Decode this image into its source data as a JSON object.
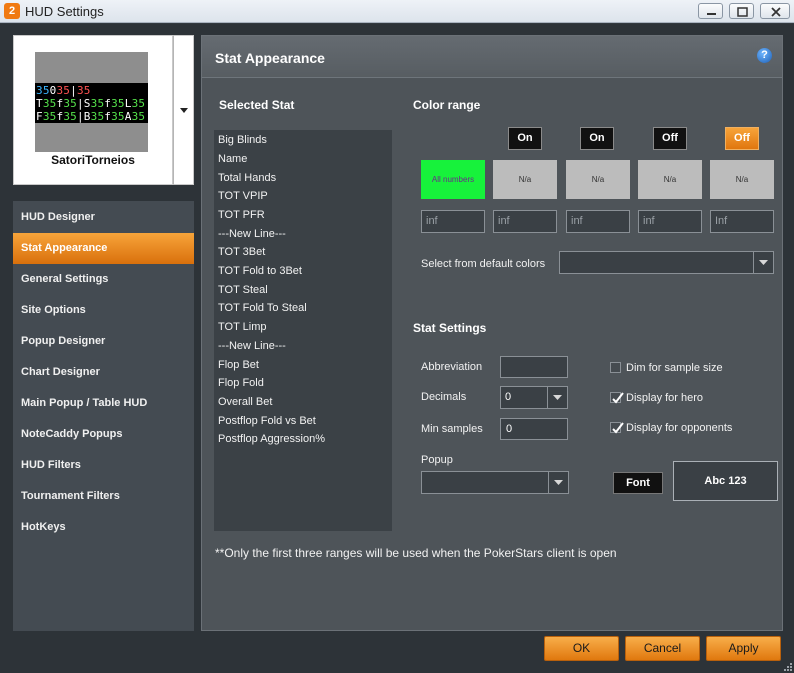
{
  "window": {
    "title": "HUD Settings",
    "app_icon": "2"
  },
  "profile": {
    "name": "SatoriTorneios",
    "preview_lines": [
      [
        [
          "35",
          "b"
        ],
        [
          "0",
          "w"
        ],
        [
          "35",
          "r"
        ],
        [
          "|",
          "w"
        ],
        [
          "35",
          "r"
        ]
      ],
      [
        [
          "T",
          "w"
        ],
        [
          "35",
          "g"
        ],
        [
          "f",
          "w"
        ],
        [
          "35",
          "g"
        ],
        [
          "|",
          "w"
        ],
        [
          "S",
          "w"
        ],
        [
          "35",
          "g"
        ],
        [
          "f",
          "w"
        ],
        [
          "35",
          "g"
        ],
        [
          "L",
          "w"
        ],
        [
          "35",
          "g"
        ]
      ],
      [
        [
          "F",
          "w"
        ],
        [
          "35",
          "g"
        ],
        [
          "f",
          "w"
        ],
        [
          "35",
          "g"
        ],
        [
          "|",
          "w"
        ],
        [
          "B",
          "w"
        ],
        [
          "35",
          "g"
        ],
        [
          "f",
          "w"
        ],
        [
          "35",
          "g"
        ],
        [
          "A",
          "w"
        ],
        [
          "35",
          "g"
        ]
      ]
    ]
  },
  "nav": {
    "items": [
      "HUD Designer",
      "Stat Appearance",
      "General Settings",
      "Site Options",
      "Popup Designer",
      "Chart Designer",
      "Main Popup / Table HUD",
      "NoteCaddy Popups",
      "HUD Filters",
      "Tournament Filters",
      "HotKeys"
    ],
    "active_index": 1
  },
  "main": {
    "title": "Stat Appearance"
  },
  "selected_stat": {
    "title": "Selected Stat",
    "items": [
      "Big Blinds",
      "Name",
      "Total Hands",
      "TOT VPIP",
      "TOT PFR",
      "---New Line---",
      "TOT 3Bet",
      "TOT Fold to 3Bet",
      "TOT Steal",
      "TOT Fold To Steal",
      "TOT Limp",
      "---New Line---",
      "Flop Bet",
      "Flop Fold",
      "Overall Bet",
      "Postflop Fold vs Bet",
      "Postflop Aggression%"
    ]
  },
  "color_range": {
    "title": "Color range",
    "toggles": [
      "On",
      "On",
      "Off",
      "Off"
    ],
    "swatches": [
      "All numbers",
      "N/a",
      "N/a",
      "N/a",
      "N/a"
    ],
    "swatch_colors": [
      "#17f23b",
      "#bcbcbc",
      "#bcbcbc",
      "#bcbcbc",
      "#bcbcbc"
    ],
    "limits": [
      "inf",
      "inf",
      "inf",
      "inf",
      "Inf"
    ],
    "default_colors_label": "Select from default colors",
    "default_colors_value": ""
  },
  "stat_settings": {
    "title": "Stat Settings",
    "abbreviation_label": "Abbreviation",
    "abbreviation_value": "",
    "decimals_label": "Decimals",
    "decimals_value": "0",
    "min_samples_label": "Min samples",
    "min_samples_value": "0",
    "popup_label": "Popup",
    "popup_value": "",
    "dim_label": "Dim for sample size",
    "dim_checked": false,
    "hero_label": "Display for hero",
    "hero_checked": true,
    "opponents_label": "Display for opponents",
    "opponents_checked": true,
    "font_label": "Font",
    "preview_text": "Abc 123"
  },
  "footnote": "**Only the first three ranges will be used when the PokerStars client is open",
  "buttons": {
    "ok": "OK",
    "cancel": "Cancel",
    "apply": "Apply"
  },
  "colors": {
    "accent": "#f0901e",
    "panel": "#4e5459",
    "background": "#2d3338"
  }
}
